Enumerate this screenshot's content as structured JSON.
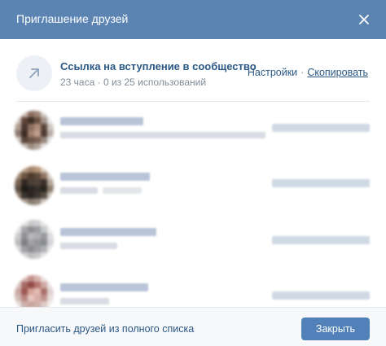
{
  "modal": {
    "title": "Приглашение друзей"
  },
  "invite_link": {
    "title": "Ссылка на вступление в сообщество",
    "meta": "23 часа · 0 из 25 использований",
    "settings_label": "Настройки",
    "separator": "·",
    "copy_label": "Скопировать"
  },
  "friends": {
    "count_visible": 4
  },
  "footer": {
    "invite_full_list_label": "Пригласить друзей из полного списка",
    "close_label": "Закрыть"
  },
  "colors": {
    "header_bg": "#5b84b3",
    "accent_link": "#2a5885",
    "primary_button": "#5181b8",
    "muted_text": "#818c99"
  }
}
